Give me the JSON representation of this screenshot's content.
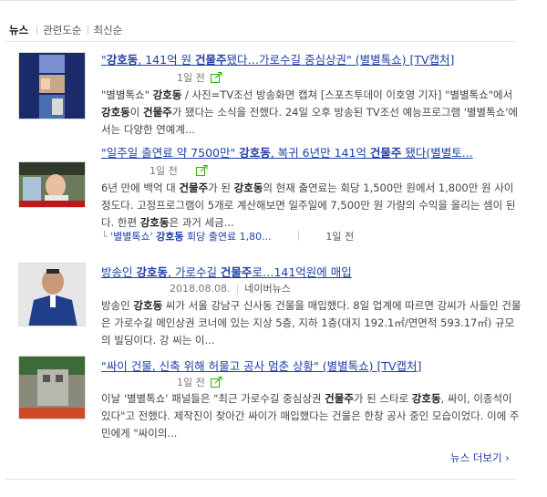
{
  "tabs": [
    {
      "label": "뉴스",
      "active": true
    },
    {
      "label": "관련도순",
      "active": false
    },
    {
      "label": "최신순",
      "active": false
    }
  ],
  "articles": [
    {
      "title_parts": {
        "pre": "\"",
        "k1": "강호동",
        "mid": ", 141억 원 ",
        "k2": "건물주",
        "post": "됐다…가로수길 중심상권\" (별별톡쇼) [TV캡처]"
      },
      "time": "1일 전",
      "desc_parts": {
        "a": "\"별별톡쇼\" ",
        "b": "강호동",
        "c": " / 사진=TV조선 방송화면 캡쳐 [스포츠투데이 이호영 기자] \"별별톡쇼\"에서 ",
        "d": "강호동",
        "e": "이 ",
        "f": "건물주",
        "g": "가 됐다는 소식을 전했다. 24일 오후 방송된 TV조선 예능프로그램 '별별톡쇼'에서는 다양한 연예계..."
      }
    },
    {
      "title_parts": {
        "pre": "\"일주일 출연료 약 7500만\" ",
        "k1": "강호동",
        "mid": ", 복귀 6년만 141억 ",
        "k2": "건물주",
        "post": " 됐다(별별토..."
      },
      "time": "1일 전",
      "desc_parts": {
        "a": "6년 만에 백억 대 ",
        "b": "건물주",
        "c": "가 된 ",
        "d": "강호동",
        "e": "의 현재 출연료는 회당 1,500만 원에서 1,800만 원 사이 정도다. 고정프로그램이 5개로 계산해보면 일주일에 7,500만 원 가량의 수익을 올리는 셈이 된다. 한편 ",
        "f": "강호동",
        "g": "은 과거 세금..."
      },
      "related": {
        "pre": "'별별톡쇼' ",
        "k": "강호동",
        "post": " 회당 출연료 1,80...",
        "time": "1일 전"
      }
    },
    {
      "title_parts": {
        "pre": "방송인 ",
        "k1": "강호동",
        "mid": ", 가로수길 ",
        "k2": "건물주",
        "post": "로…141억원에 매입"
      },
      "date": "2018.08.08.",
      "source": "네이버뉴스",
      "desc_parts": {
        "a": "방송인 ",
        "b": "강호동",
        "c": " 씨가 서울 강남구 신사동 건물을 매입했다. 8일 업계에 따르면 강씨가 사들인 건물은 가로수길 메인상권 코너에 있는 지상 5층, 지하 1층(대지 192.1㎡/연면적 593.17㎡) 규모의 빌딩이다. 강 씨는 이..."
      }
    },
    {
      "title_parts": {
        "pre": "\"싸이 건물, 신축 위해 허물고 공사 멈춘 상황\" (별별톡쇼) [TV캡처]"
      },
      "time": "1일 전",
      "desc_parts": {
        "a": "이날 '별별톡쇼' 패널들은 \"최근 가로수길 중심상권 ",
        "b": "건물주",
        "c": "가 된 스타로 ",
        "d": "강호동",
        "e": ", 싸이, 이종석이 있다\"고 전했다. 제작진이 찾아간 싸이가 매입했다는 건물은 한창 공사 중인 모습이었다. 이에 주민에게 \"싸이의..."
      }
    }
  ],
  "more_label": "뉴스 더보기 ›",
  "colors": {
    "link": "#1f3fa6",
    "share_icon": "#2db400"
  }
}
